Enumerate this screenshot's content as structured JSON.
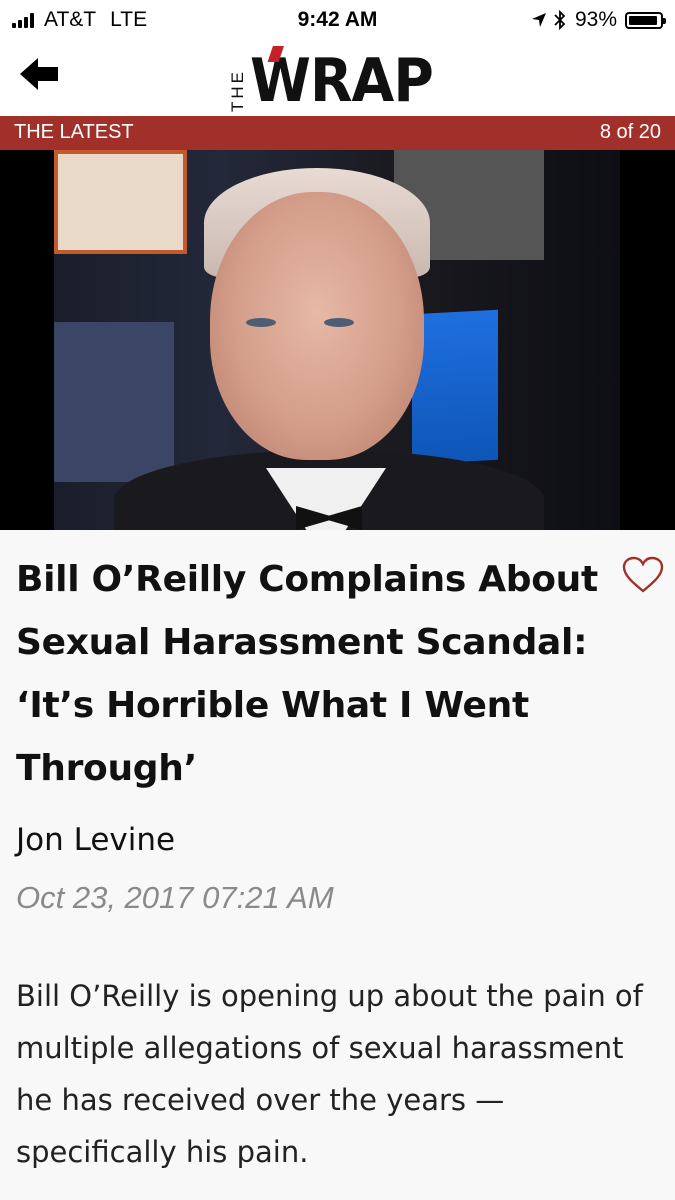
{
  "status_bar": {
    "carrier": "AT&T",
    "network": "LTE",
    "time": "9:42 AM",
    "battery_pct": "93%"
  },
  "nav": {
    "back_icon": "arrow-left-icon",
    "logo_small": "THE",
    "logo_main": "WRAP"
  },
  "section": {
    "label": "THE LATEST",
    "counter": "8 of 20"
  },
  "hero": {
    "subject": "photo"
  },
  "article": {
    "headline": "Bill O’Reilly Complains About Sexual Harassment Scandal: ‘It’s Horrible What I Went Through’",
    "author": "Jon Levine",
    "date": "Oct 23, 2017 07:21 AM",
    "body": "Bill O’Reilly is opening up about the pain of multiple allegations of sexual harassment he has received over the years — specifically his pain.",
    "favorite_icon": "heart-outline-icon"
  },
  "colors": {
    "section_bar": "#a2302a",
    "heart": "#a2302a",
    "timestamp": "#8a8a8a"
  }
}
